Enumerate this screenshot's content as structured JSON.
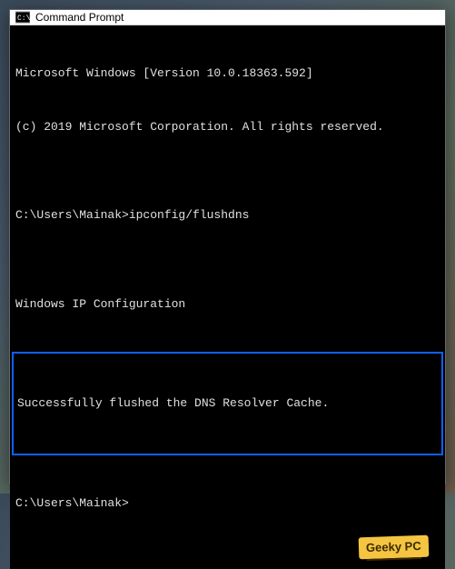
{
  "titlebar": {
    "label": "Command Prompt"
  },
  "terminal": {
    "line1": "Microsoft Windows [Version 10.0.18363.592]",
    "line2": "(c) 2019 Microsoft Corporation. All rights reserved.",
    "blank1": "",
    "prompt1": "C:\\Users\\Mainak>ipconfig/flushdns",
    "blank2": "",
    "header": "Windows IP Configuration",
    "success": "Successfully flushed the DNS Resolver Cache.",
    "blank3": "",
    "prompt2": "C:\\Users\\Mainak>"
  },
  "watermark": {
    "text": "Geeky PC"
  }
}
